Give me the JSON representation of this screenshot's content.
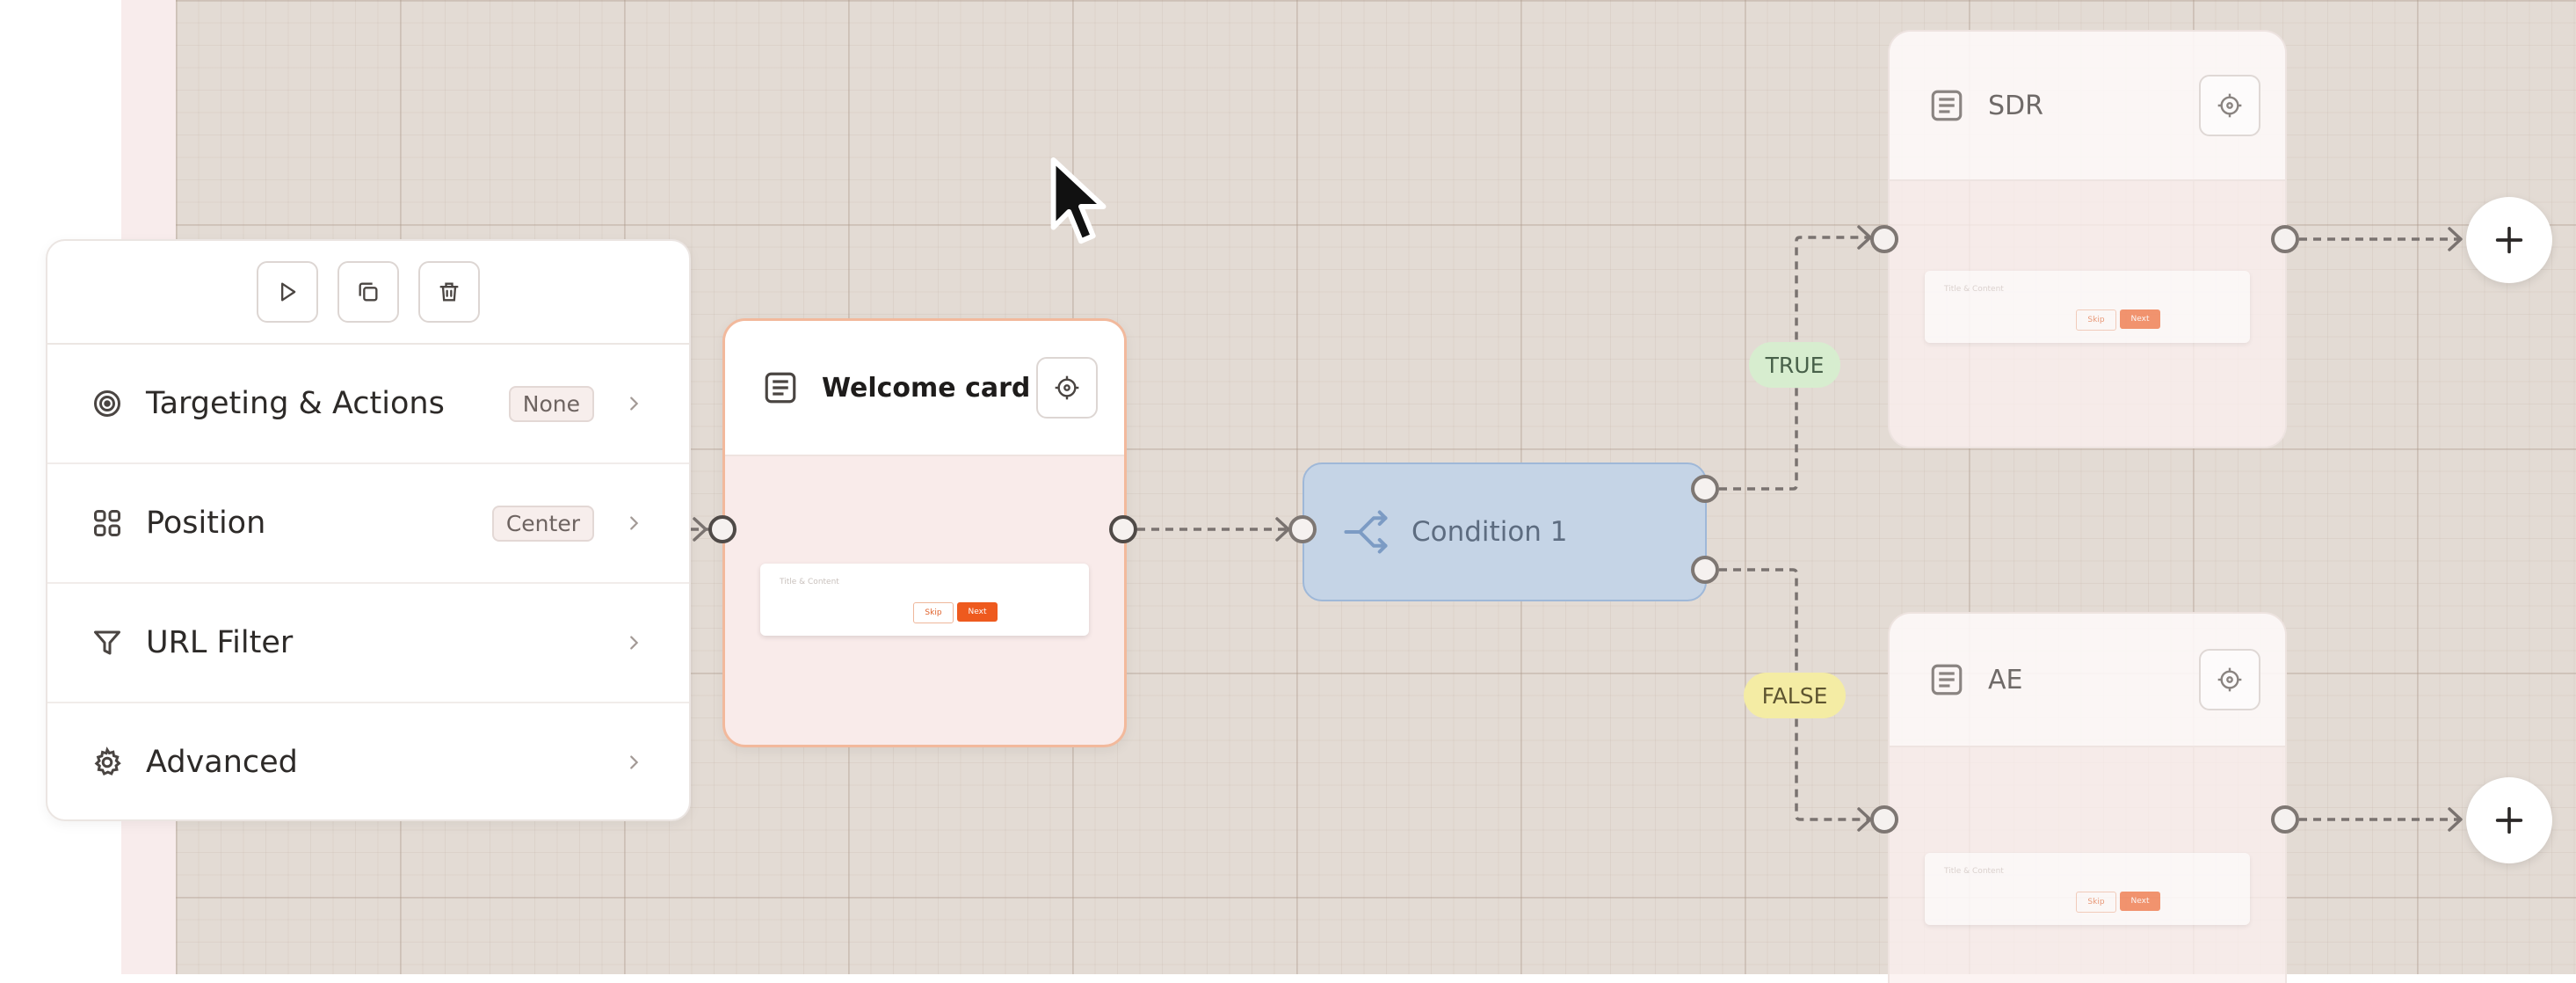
{
  "panel": {
    "toolbar": [
      "play-icon",
      "duplicate-icon",
      "trash-icon"
    ],
    "rows": [
      {
        "label": "Targeting & Actions",
        "badge": "None",
        "icon": "target-icon"
      },
      {
        "label": "Position",
        "badge": "Center",
        "icon": "grid-icon"
      },
      {
        "label": "URL Filter",
        "badge": "",
        "icon": "filter-icon"
      },
      {
        "label": "Advanced",
        "badge": "",
        "icon": "gear-icon"
      }
    ]
  },
  "welcome": {
    "title": "Welcome card",
    "preview": {
      "text": "Title & Content",
      "skip": "Skip",
      "next": "Next"
    }
  },
  "condition": {
    "label": "Condition 1"
  },
  "branches": {
    "true_label": "TRUE",
    "false_label": "FALSE"
  },
  "sdr": {
    "title": "SDR",
    "preview": {
      "text": "Title & Content",
      "skip": "Skip",
      "next": "Next"
    }
  },
  "ae": {
    "title": "AE",
    "preview": {
      "text": "Title & Content",
      "skip": "Skip",
      "next": "Next"
    }
  },
  "colors": {
    "accent": "#ee5a1e",
    "condition_fill": "#c5d4e6",
    "true_badge": "#d7edcf",
    "false_badge": "#f4eca4",
    "canvas": "#e3dbd4"
  }
}
